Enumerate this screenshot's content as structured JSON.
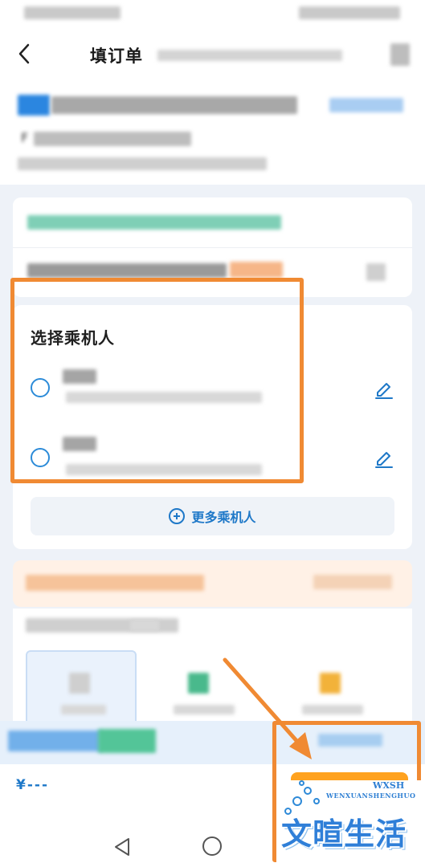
{
  "header": {
    "title": "填订单"
  },
  "flight_info": {
    "partial_char": "F"
  },
  "passengers": {
    "section_title": "选择乘机人",
    "more_label": "更多乘机人"
  },
  "bottom": {
    "price": "¥---"
  },
  "watermark": {
    "abbr": "WXSH",
    "subtitle": "WENXUANSHENGHUO",
    "main": "文暄生活"
  },
  "colors": {
    "accent_blue": "#1e78c8",
    "annotation_orange": "#f08a33",
    "order_orange": "#ffa21f"
  }
}
